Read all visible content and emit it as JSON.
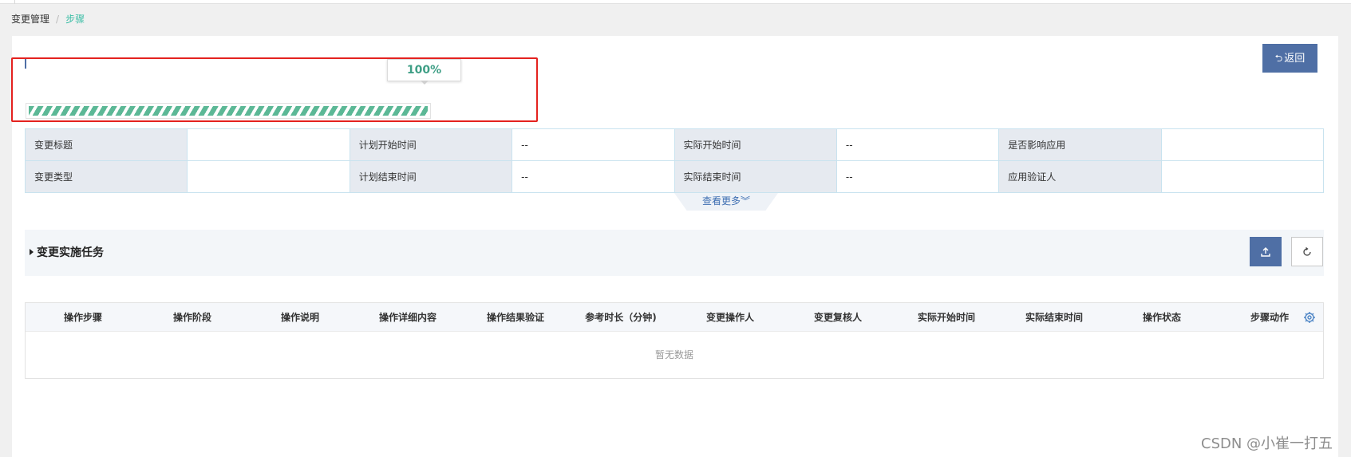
{
  "breadcrumb": {
    "parent": "变更管理",
    "current": "步骤",
    "separator": "/"
  },
  "actions": {
    "back_label": "返回",
    "back_icon": "undo-arrow-icon"
  },
  "progress": {
    "percent_label": "100%",
    "value": 1.0,
    "fill_color": "#5cb896"
  },
  "info": {
    "rows": [
      [
        {
          "label": "变更标题",
          "value": ""
        },
        {
          "label": "计划开始时间",
          "value": "--"
        },
        {
          "label": "实际开始时间",
          "value": "--"
        },
        {
          "label": "是否影响应用",
          "value": ""
        }
      ],
      [
        {
          "label": "变更类型",
          "value": ""
        },
        {
          "label": "计划结束时间",
          "value": "--"
        },
        {
          "label": "实际结束时间",
          "value": "--"
        },
        {
          "label": "应用验证人",
          "value": ""
        }
      ]
    ],
    "more_label": "查看更多"
  },
  "section": {
    "title": "变更实施任务",
    "upload_icon": "upload-icon",
    "refresh_icon": "refresh-icon"
  },
  "grid": {
    "columns": [
      "操作步骤",
      "操作阶段",
      "操作说明",
      "操作详细内容",
      "操作结果验证",
      "参考时长（分钟)",
      "变更操作人",
      "变更复核人",
      "实际开始时间",
      "实际结束时间",
      "操作状态",
      "步骤动作"
    ],
    "empty_text": "暂无数据",
    "settings_icon": "gear-icon"
  },
  "watermark": "CSDN @小崔一打五",
  "colors": {
    "primary": "#4f6fa5",
    "accent": "#3dbea6",
    "highlight": "#e4221f",
    "label_bg": "#e6eaf0"
  }
}
